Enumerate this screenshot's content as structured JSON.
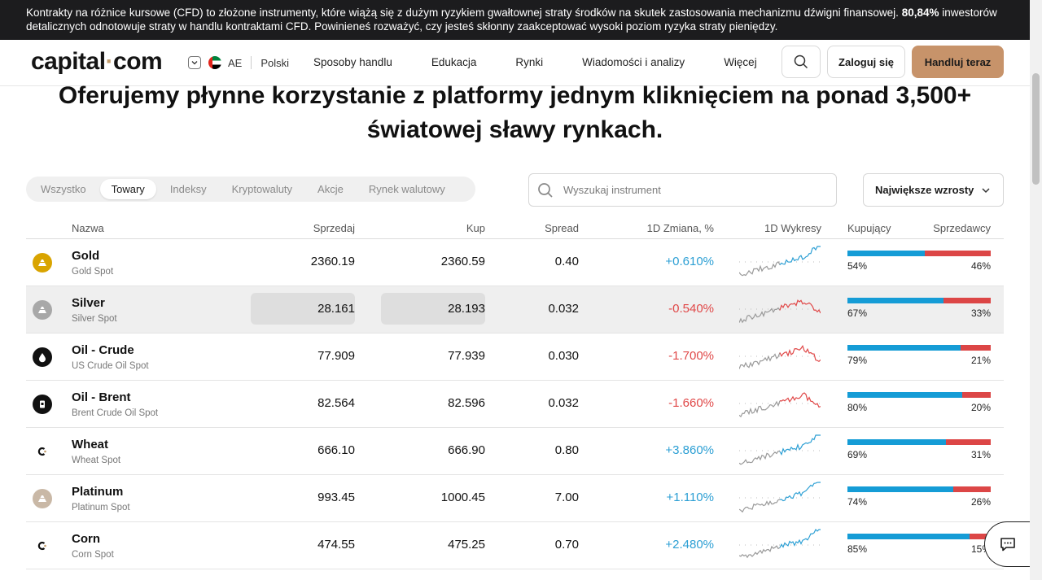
{
  "risk_banner": {
    "text": "Kontrakty na różnice kursowe (CFD) to złożone instrumenty, które wiążą się z dużym ryzykiem gwałtownej straty środków na skutek zastosowania mechanizmu dźwigni finansowej.",
    "percent": "80,84%",
    "text2": "inwestorów detalicznych odnotowuje straty w handlu kontraktami CFD. Powinieneś rozważyć, czy jesteś skłonny zaakceptować wysoki poziom ryzyka straty pieniędzy."
  },
  "header": {
    "logo_left": "capital",
    "logo_dot": "·",
    "logo_right": "com",
    "region": "AE",
    "language": "Polski",
    "nav": [
      "Sposoby handlu",
      "Edukacja",
      "Rynki",
      "Wiadomości i analizy",
      "Więcej"
    ],
    "login": "Zaloguj się",
    "trade": "Handluj teraz"
  },
  "headline": {
    "line1": "Oferujemy płynne korzystanie z platformy jednym kliknięciem na ponad 3,500+",
    "line2": "światowej sławy rynkach."
  },
  "filters": {
    "tabs": [
      "Wszystko",
      "Towary",
      "Indeksy",
      "Kryptowaluty",
      "Akcje",
      "Rynek walutowy"
    ],
    "active_tab": "Towary",
    "search_placeholder": "Wyszukaj instrument",
    "sort": "Największe wzrosty"
  },
  "table": {
    "headers": {
      "name": "Nazwa",
      "sell": "Sprzedaj",
      "buy": "Kup",
      "spread": "Spread",
      "change": "1D Zmiana, %",
      "chart": "1D Wykresy",
      "buyers": "Kupujący",
      "sellers": "Sprzedawcy"
    },
    "rows": [
      {
        "name": "Gold",
        "sub": "Gold Spot",
        "sell": "2360.19",
        "buy": "2360.59",
        "spread": "0.40",
        "change": "+0.610%",
        "dir": "pos",
        "buyers": "54%",
        "sellers": "46%",
        "buyers_frac": 0.54,
        "icon": "gold-bars-icon",
        "icon_color": "#d9a400"
      },
      {
        "name": "Silver",
        "sub": "Silver Spot",
        "sell": "28.161",
        "buy": "28.193",
        "spread": "0.032",
        "change": "-0.540%",
        "dir": "neg",
        "buyers": "67%",
        "sellers": "33%",
        "buyers_frac": 0.67,
        "icon": "silver-bars-icon",
        "icon_color": "#a8a8a8"
      },
      {
        "name": "Oil - Crude",
        "sub": "US Crude Oil Spot",
        "sell": "77.909",
        "buy": "77.939",
        "spread": "0.030",
        "change": "-1.700%",
        "dir": "neg",
        "buyers": "79%",
        "sellers": "21%",
        "buyers_frac": 0.79,
        "icon": "oil-drop-icon",
        "icon_color": "#111111"
      },
      {
        "name": "Oil - Brent",
        "sub": "Brent Crude Oil Spot",
        "sell": "82.564",
        "buy": "82.596",
        "spread": "0.032",
        "change": "-1.660%",
        "dir": "neg",
        "buyers": "80%",
        "sellers": "20%",
        "buyers_frac": 0.8,
        "icon": "oil-barrel-icon",
        "icon_color": "#111111"
      },
      {
        "name": "Wheat",
        "sub": "Wheat Spot",
        "sell": "666.10",
        "buy": "666.90",
        "spread": "0.80",
        "change": "+3.860%",
        "dir": "pos",
        "buyers": "69%",
        "sellers": "31%",
        "buyers_frac": 0.69,
        "icon": "capital-logo-icon",
        "icon_color": "#ffffff"
      },
      {
        "name": "Platinum",
        "sub": "Platinum Spot",
        "sell": "993.45",
        "buy": "1000.45",
        "spread": "7.00",
        "change": "+1.110%",
        "dir": "pos",
        "buyers": "74%",
        "sellers": "26%",
        "buyers_frac": 0.74,
        "icon": "platinum-bars-icon",
        "icon_color": "#c9b8a6"
      },
      {
        "name": "Corn",
        "sub": "Corn Spot",
        "sell": "474.55",
        "buy": "475.25",
        "spread": "0.70",
        "change": "+2.480%",
        "dir": "pos",
        "buyers": "85%",
        "sellers": "15%",
        "buyers_frac": 0.85,
        "icon": "capital-logo-icon",
        "icon_color": "#ffffff"
      }
    ]
  }
}
